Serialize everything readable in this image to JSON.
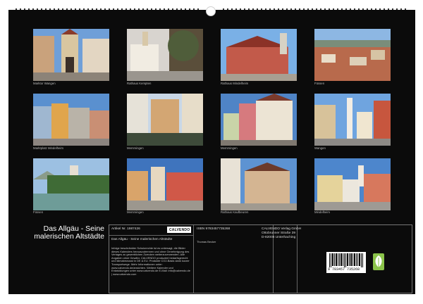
{
  "sheet_title": "Das Allgäu - Seine malerischen Altstädte",
  "photos": [
    {
      "caption": "Marktor Wangen"
    },
    {
      "caption": "Rathaus Kempten"
    },
    {
      "caption": "Rathaus Mindelheim"
    },
    {
      "caption": "Füssen"
    },
    {
      "caption": "Marktplatz Mindelheim"
    },
    {
      "caption": "Memmingen"
    },
    {
      "caption": "Memmingen"
    },
    {
      "caption": "Wangen"
    },
    {
      "caption": "Füssen"
    },
    {
      "caption": "Memmingen"
    },
    {
      "caption": "Rathaus Kaufbeuren"
    },
    {
      "caption": "Mindelheim"
    }
  ],
  "info": {
    "article_no": "Artikel Nr. 1987426",
    "calendar_title": "Das Allgäu - Seine malerischen Altstädte",
    "description": "Infolge beschränkter Schutzrechte ist es untersagt, die Bilder dieses Kalenders herauszutrennen und ohne Genehmigung des Verlages zu gewerblichen Zwecken weiterzuverwenden. Alle Angaben ohne Gewähr. CALVENDO produziert bedarfsgerecht und klimabewusst in DE & EU. Produkte CO2-Basis dank kurzer Transportwege. Mehr Informationen unter: www.calvendo.de/ansichten. Weitere Kalender und Entwicklungen unter www.calvendo.de E-Mail: info@calvendo.de | www.calvendo.com",
    "isbn": "ISBN 9783457735268",
    "author": "Thomas Becker",
    "publisher_name": "CALVENDO Verlag GmbH",
    "publisher_street": "Ottobrunner Straße 39",
    "publisher_city": "D-82008 Unterhaching",
    "barcode_number": "9 783457 735268",
    "logo_text": "CALVENDO"
  }
}
